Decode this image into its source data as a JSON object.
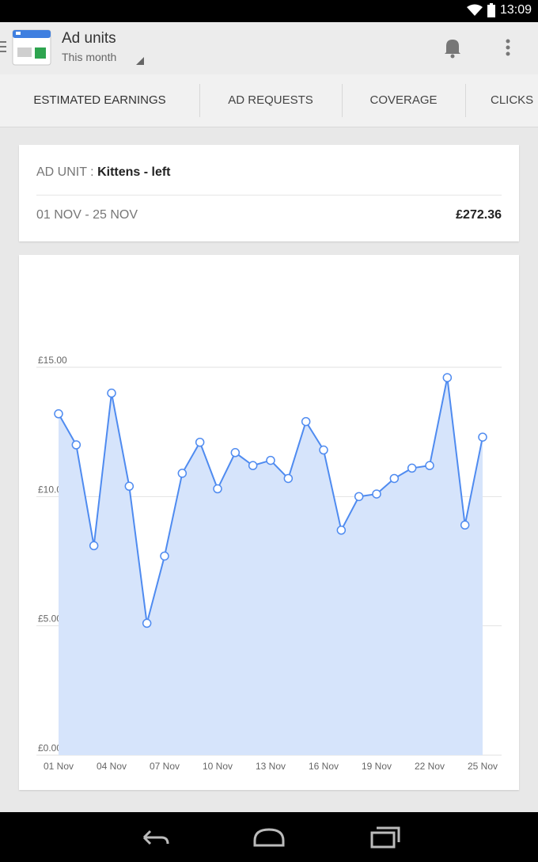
{
  "status_bar": {
    "time": "13:09",
    "icons": [
      "wifi-icon",
      "battery-icon"
    ]
  },
  "app_bar": {
    "title": "Ad units",
    "subtitle": "This month"
  },
  "tabs": [
    {
      "label": "ESTIMATED EARNINGS",
      "active": true
    },
    {
      "label": "AD REQUESTS",
      "active": false
    },
    {
      "label": "COVERAGE",
      "active": false
    },
    {
      "label": "CLICKS",
      "active": false
    }
  ],
  "summary": {
    "ad_unit_label": "AD UNIT :",
    "ad_unit_name": "Kittens - left",
    "date_range": "01 NOV - 25 NOV",
    "total": "£272.36"
  },
  "colors": {
    "accent": "#3f7fe0",
    "line": "#4f8bf0",
    "area": "#d6e4fb",
    "tab_indicator": "#3f7fe0"
  },
  "chart_data": {
    "type": "area",
    "x": [
      "01 Nov",
      "02 Nov",
      "03 Nov",
      "04 Nov",
      "05 Nov",
      "06 Nov",
      "07 Nov",
      "08 Nov",
      "09 Nov",
      "10 Nov",
      "11 Nov",
      "12 Nov",
      "13 Nov",
      "14 Nov",
      "15 Nov",
      "16 Nov",
      "17 Nov",
      "18 Nov",
      "19 Nov",
      "20 Nov",
      "21 Nov",
      "22 Nov",
      "23 Nov",
      "24 Nov",
      "25 Nov"
    ],
    "y": [
      13.2,
      12.0,
      8.1,
      14.0,
      10.4,
      5.1,
      7.7,
      10.9,
      12.1,
      10.3,
      11.7,
      11.2,
      11.4,
      10.7,
      12.9,
      11.8,
      8.7,
      10.0,
      10.1,
      10.7,
      11.1,
      11.2,
      14.6,
      8.9,
      12.3
    ],
    "yticks": [
      "£0.00",
      "£5.00",
      "£10.00",
      "£15.00"
    ],
    "ytick_values": [
      0,
      5,
      10,
      15
    ],
    "xticks": [
      "01 Nov",
      "04 Nov",
      "07 Nov",
      "10 Nov",
      "13 Nov",
      "16 Nov",
      "19 Nov",
      "22 Nov",
      "25 Nov"
    ],
    "xtick_indices": [
      0,
      3,
      6,
      9,
      12,
      15,
      18,
      21,
      24
    ],
    "ylim": [
      0,
      15
    ],
    "grid": true
  },
  "nav_bar": {
    "buttons": [
      "back-icon",
      "home-icon",
      "recents-icon"
    ]
  }
}
